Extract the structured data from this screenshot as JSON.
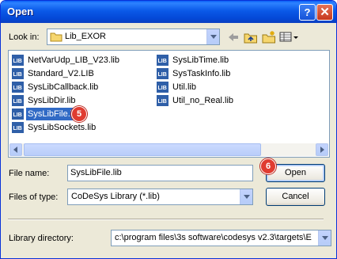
{
  "window": {
    "title": "Open",
    "help_glyph": "?",
    "close_glyph": "✕"
  },
  "look_in": {
    "label": "Look in:",
    "value": "Lib_EXOR"
  },
  "toolbar_icons": [
    "back-icon",
    "up-folder-icon",
    "new-folder-icon",
    "view-menu-icon"
  ],
  "files": [
    {
      "name": "NetVarUdp_LIB_V23.lib"
    },
    {
      "name": "Standard_V2.LIB"
    },
    {
      "name": "SysLibCallback.lib"
    },
    {
      "name": "SysLibDir.lib"
    },
    {
      "name": "SysLibFile.lib",
      "selected": true
    },
    {
      "name": "SysLibSockets.lib"
    },
    {
      "name": "SysLibTime.lib"
    },
    {
      "name": "SysTaskInfo.lib"
    },
    {
      "name": "Util.lib"
    },
    {
      "name": "Util_no_Real.lib"
    }
  ],
  "annotations": {
    "step5": "5",
    "step6": "6"
  },
  "file_name": {
    "label": "File name:",
    "value": "SysLibFile.lib"
  },
  "files_of_type": {
    "label": "Files of type:",
    "value": "CoDeSys Library (*.lib)"
  },
  "buttons": {
    "open": "Open",
    "cancel": "Cancel"
  },
  "library_directory": {
    "label": "Library directory:",
    "value": "c:\\program files\\3s software\\codesys v2.3\\targets\\E"
  },
  "colors": {
    "titlebar": "#0a59e8",
    "selection": "#316ac5",
    "badge": "#e03c31",
    "dialog_bg": "#ece9d8"
  }
}
